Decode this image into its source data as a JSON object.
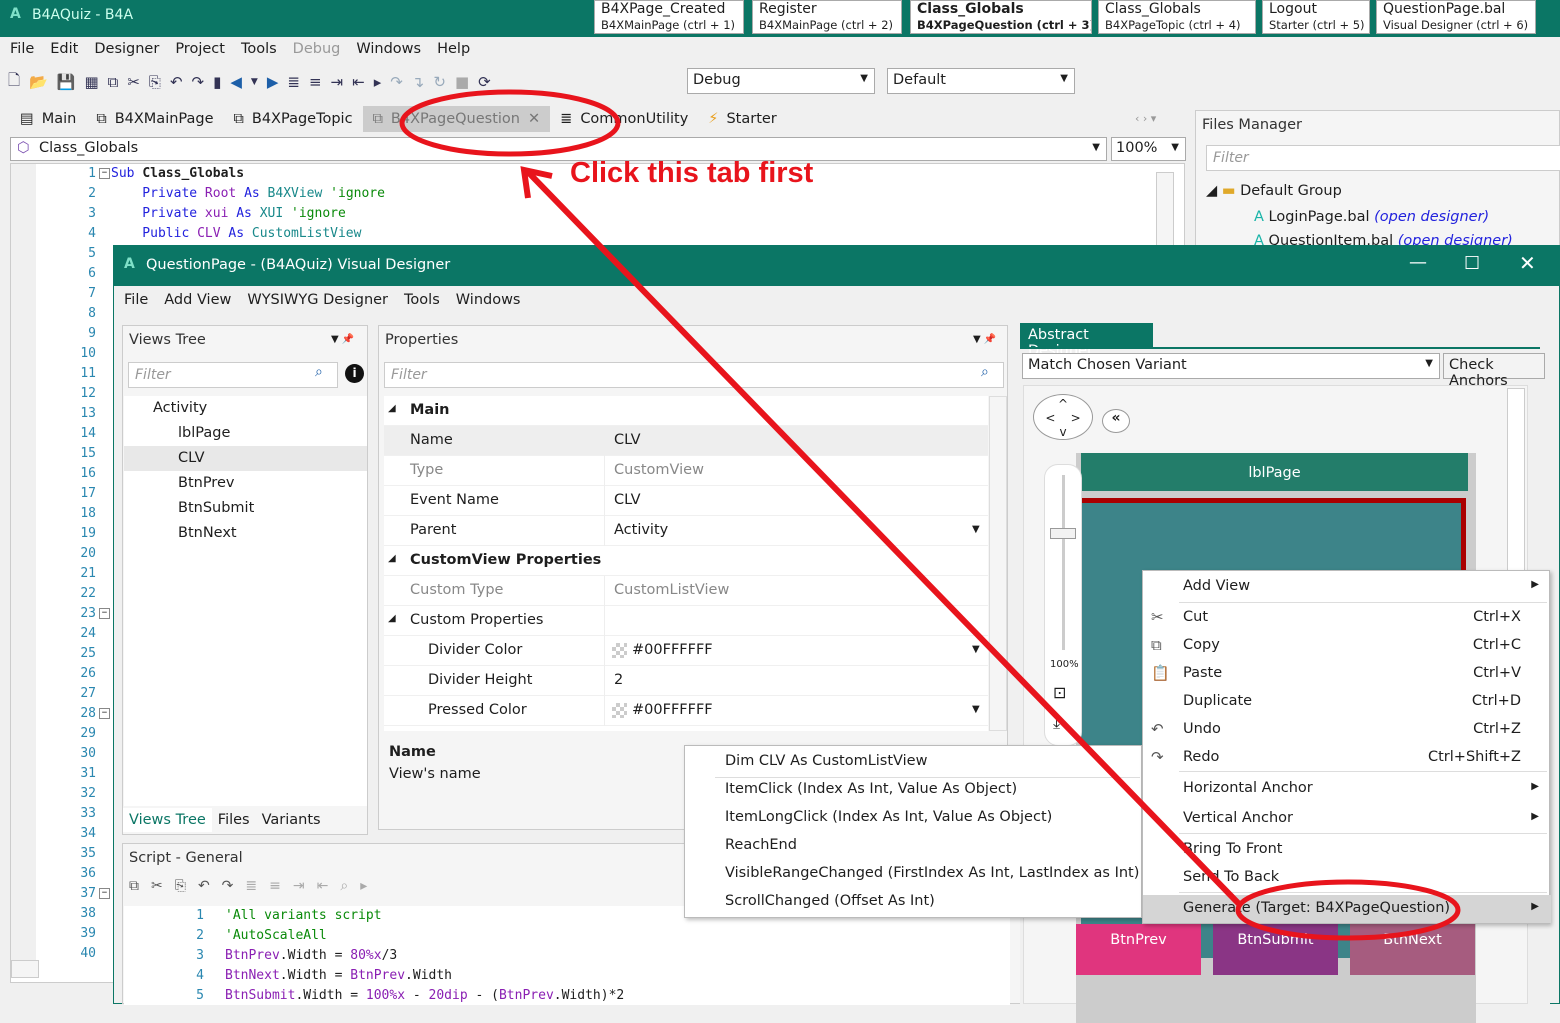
{
  "app": {
    "title": "B4AQuiz - B4A",
    "logo": "A"
  },
  "doc_tabs": [
    {
      "title": "B4XPage_Created",
      "sub": "B4XMainPage  (ctrl + 1)"
    },
    {
      "title": "Register",
      "sub": "B4XMainPage  (ctrl + 2)"
    },
    {
      "title": "Class_Globals",
      "sub": "B4XPageQuestion  (ctrl + 3)",
      "active": true
    },
    {
      "title": "Class_Globals",
      "sub": "B4XPageTopic  (ctrl + 4)"
    },
    {
      "title": "Logout",
      "sub": "Starter  (ctrl + 5)"
    },
    {
      "title": "QuestionPage.bal",
      "sub": "Visual Designer  (ctrl + 6)"
    }
  ],
  "menu": [
    "File",
    "Edit",
    "Designer",
    "Project",
    "Tools",
    "Debug",
    "Windows",
    "Help"
  ],
  "toolbar": {
    "build": "Debug",
    "config": "Default"
  },
  "module_tabs": [
    "Main",
    "B4XMainPage",
    "B4XPageTopic",
    "B4XPageQuestion",
    "CommonUtility",
    "Starter"
  ],
  "sub_combo": "Class_Globals",
  "zoom": "100%",
  "code": {
    "lines": [
      [
        {
          "t": "Sub ",
          "c": "kw"
        },
        {
          "t": "Class_Globals",
          "c": "b"
        }
      ],
      [
        {
          "t": "    Private ",
          "c": "kw"
        },
        {
          "t": "Root ",
          "c": "vr"
        },
        {
          "t": "As ",
          "c": "kw"
        },
        {
          "t": "B4XView ",
          "c": "ty"
        },
        {
          "t": "'ignore",
          "c": "cm"
        }
      ],
      [
        {
          "t": "    Private ",
          "c": "kw"
        },
        {
          "t": "xui ",
          "c": "vr"
        },
        {
          "t": "As ",
          "c": "kw"
        },
        {
          "t": "XUI ",
          "c": "ty"
        },
        {
          "t": "'ignore",
          "c": "cm"
        }
      ],
      [
        {
          "t": "    Public ",
          "c": "kw"
        },
        {
          "t": "CLV ",
          "c": "vr"
        },
        {
          "t": "As ",
          "c": "kw"
        },
        {
          "t": "CustomListView",
          "c": "ty"
        }
      ]
    ],
    "line_count": 40
  },
  "files_manager": {
    "title": "Files Manager",
    "filter": "Filter",
    "group": "Default Group",
    "files": [
      {
        "name": "LoginPage.bal",
        "link": "(open designer)"
      },
      {
        "name": "QuestionItem.bal",
        "link": "(open designer)"
      }
    ]
  },
  "designer": {
    "title": "QuestionPage - (B4AQuiz) Visual Designer",
    "menu": [
      "File",
      "Add View",
      "WYSIWYG Designer",
      "Tools",
      "Windows"
    ]
  },
  "views_tree": {
    "title": "Views Tree",
    "filter": "Filter",
    "items": [
      "Activity",
      "lblPage",
      "CLV",
      "BtnPrev",
      "BtnSubmit",
      "BtnNext"
    ],
    "selected": "CLV",
    "tabs": [
      "Views Tree",
      "Files",
      "Variants"
    ]
  },
  "properties": {
    "title": "Properties",
    "filter": "Filter",
    "rows": [
      {
        "k": "Main",
        "sec": true
      },
      {
        "k": "Name",
        "v": "CLV"
      },
      {
        "k": "Type",
        "v": "CustomView",
        "g": true
      },
      {
        "k": "Event Name",
        "v": "CLV"
      },
      {
        "k": "Parent",
        "v": "Activity",
        "dd": true
      },
      {
        "k": "CustomView Properties",
        "sec": true
      },
      {
        "k": "Custom Type",
        "v": "CustomListView",
        "g": true
      },
      {
        "k": "Custom Properties",
        "sub": true
      },
      {
        "k": "Divider Color",
        "v": "#00FFFFFF",
        "dd": true,
        "sw": true,
        "ind": true
      },
      {
        "k": "Divider Height",
        "v": "2",
        "ind": true
      },
      {
        "k": "Pressed Color",
        "v": "#00FFFFFF",
        "dd": true,
        "sw": true,
        "ind": true
      }
    ],
    "desc_title": "Name",
    "desc": "View's name"
  },
  "abstract": {
    "title": "Abstract Designer",
    "variant": "Match Chosen Variant",
    "check": "Check Anchors",
    "zoom": "100%",
    "views": {
      "label": "lblPage",
      "prev": "BtnPrev",
      "submit": "BtnSubmit",
      "next": "BtnNext"
    }
  },
  "script": {
    "title": "Script - General",
    "lines": [
      [
        {
          "t": "'All variants script",
          "c": "cm"
        }
      ],
      [
        {
          "t": "'AutoScaleAll",
          "c": "cm"
        }
      ],
      [
        {
          "t": "BtnPrev",
          "c": "vr"
        },
        {
          "t": ".Width = "
        },
        {
          "t": "80%x",
          "c": "vr"
        },
        {
          "t": "/3"
        }
      ],
      [
        {
          "t": "BtnNext",
          "c": "vr"
        },
        {
          "t": ".Width = "
        },
        {
          "t": "BtnPrev",
          "c": "vr"
        },
        {
          "t": ".Width"
        }
      ],
      [
        {
          "t": "BtnSubmit",
          "c": "vr"
        },
        {
          "t": ".Width = "
        },
        {
          "t": "100%x",
          "c": "vr"
        },
        {
          "t": " - "
        },
        {
          "t": "20dip",
          "c": "vr"
        },
        {
          "t": " - ("
        },
        {
          "t": "BtnPrev",
          "c": "vr"
        },
        {
          "t": ".Width)*2"
        }
      ]
    ]
  },
  "events": [
    "Dim CLV As CustomListView",
    "ItemClick (Index As Int, Value As Object)",
    "ItemLongClick (Index As Int, Value As Object)",
    "ReachEnd",
    "VisibleRangeChanged (FirstIndex As Int, LastIndex as Int)",
    "ScrollChanged (Offset As Int)"
  ],
  "context_menu": [
    {
      "l": "Add View",
      "sub": true
    },
    {
      "l": "Cut",
      "s": "Ctrl+X",
      "i": "cut-icon",
      "g": "✂"
    },
    {
      "l": "Copy",
      "s": "Ctrl+C",
      "i": "copy-icon",
      "g": "⧉"
    },
    {
      "l": "Paste",
      "s": "Ctrl+V",
      "i": "paste-icon",
      "g": "📋"
    },
    {
      "l": "Duplicate",
      "s": "Ctrl+D"
    },
    {
      "l": "Undo",
      "s": "Ctrl+Z",
      "i": "undo-icon",
      "g": "↶"
    },
    {
      "l": "Redo",
      "s": "Ctrl+Shift+Z",
      "i": "redo-icon",
      "g": "↷"
    },
    {
      "l": "Horizontal Anchor",
      "sub": true
    },
    {
      "l": "Vertical Anchor",
      "sub": true
    },
    {
      "l": "Bring To Front"
    },
    {
      "l": "Send To Back"
    },
    {
      "l": "Generate (Target: B4XPageQuestion)",
      "sub": true,
      "hl": true
    }
  ],
  "annotation": {
    "text": "Click this tab first",
    "color": "#e8141c"
  },
  "colors": {
    "teal": "#0b7665",
    "prev": "#e0357e",
    "submit": "#8a3585",
    "next": "#a65c7f"
  }
}
